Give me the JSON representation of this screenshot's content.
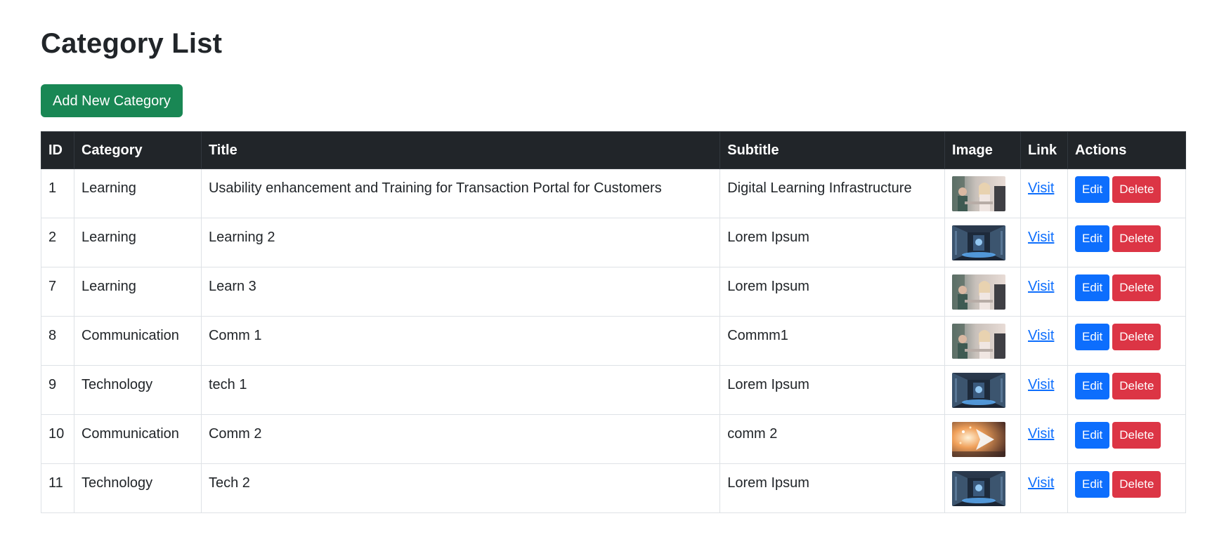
{
  "page": {
    "title": "Category List",
    "add_button_label": "Add New Category"
  },
  "table": {
    "headers": [
      "ID",
      "Category",
      "Title",
      "Subtitle",
      "Image",
      "Link",
      "Actions"
    ],
    "rows": [
      {
        "id": "1",
        "category": "Learning",
        "title": "Usability enhancement and Training for Transaction Portal for Customers",
        "subtitle": "Digital Learning Infrastructure",
        "image": "office-meeting-thumbnail",
        "link": "Visit",
        "edit": "Edit",
        "delete": "Delete"
      },
      {
        "id": "2",
        "category": "Learning",
        "title": "Learning 2",
        "subtitle": "Lorem Ipsum",
        "image": "server-hallway-thumbnail",
        "link": "Visit",
        "edit": "Edit",
        "delete": "Delete"
      },
      {
        "id": "7",
        "category": "Learning",
        "title": "Learn 3",
        "subtitle": "Lorem Ipsum",
        "image": "office-meeting-thumbnail",
        "link": "Visit",
        "edit": "Edit",
        "delete": "Delete"
      },
      {
        "id": "8",
        "category": "Communication",
        "title": "Comm 1",
        "subtitle": "Commm1",
        "image": "office-meeting-thumbnail",
        "link": "Visit",
        "edit": "Edit",
        "delete": "Delete"
      },
      {
        "id": "9",
        "category": "Technology",
        "title": "tech 1",
        "subtitle": "Lorem Ipsum",
        "image": "server-hallway-thumbnail",
        "link": "Visit",
        "edit": "Edit",
        "delete": "Delete"
      },
      {
        "id": "10",
        "category": "Communication",
        "title": "Comm 2",
        "subtitle": "comm 2",
        "image": "glowing-arrow-thumbnail",
        "link": "Visit",
        "edit": "Edit",
        "delete": "Delete"
      },
      {
        "id": "11",
        "category": "Technology",
        "title": "Tech 2",
        "subtitle": "Lorem Ipsum",
        "image": "server-hallway-thumbnail",
        "link": "Visit",
        "edit": "Edit",
        "delete": "Delete"
      }
    ]
  },
  "colors": {
    "add_button": "#198754",
    "header_bg": "#212529",
    "edit_button": "#0d6efd",
    "delete_button": "#dc3545",
    "link": "#0d6efd"
  }
}
